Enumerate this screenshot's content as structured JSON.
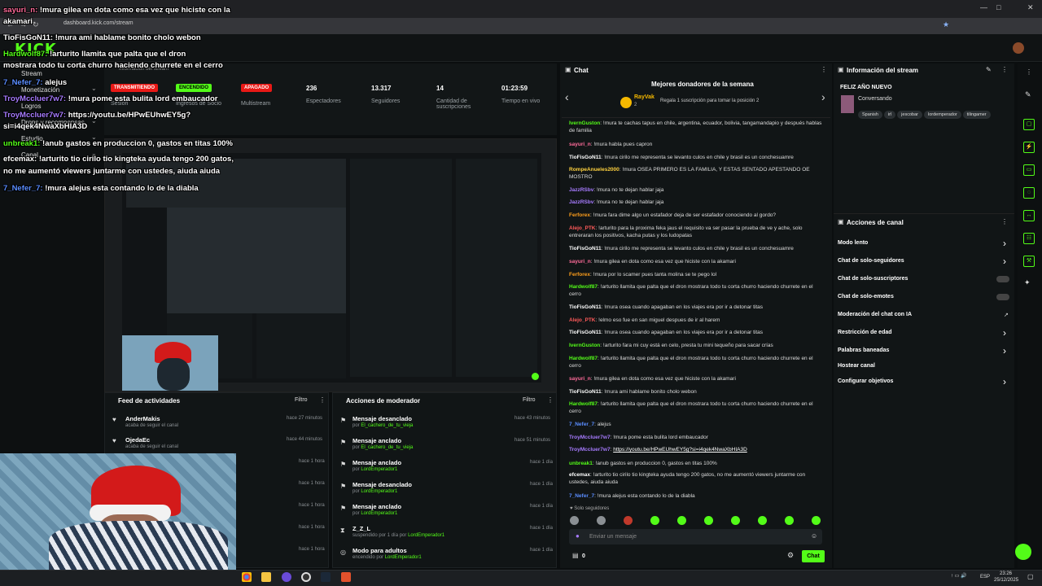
{
  "browser": {
    "url": "dashboard.kick.com/stream",
    "win_min": "—",
    "win_max": "□",
    "win_close": "✕",
    "back_glyph": "←",
    "fwd_glyph": "→",
    "reload_glyph": "↻",
    "star_glyph": "★"
  },
  "app": {
    "logo": "KICK"
  },
  "sidebar": {
    "items": [
      {
        "label": "Stream"
      },
      {
        "label": "Monetización"
      },
      {
        "label": "Logros"
      },
      {
        "label": "Drops y recompensas"
      },
      {
        "label": "Estudio"
      },
      {
        "label": "Canal"
      }
    ],
    "chevron": "⌄"
  },
  "stats": {
    "header": "Información del stream",
    "session": {
      "badge": "TRANSMITIENDO",
      "label": "Sesión"
    },
    "income": {
      "badge": "ENCENDIDO",
      "label": "Ingresos de Socio"
    },
    "multistream": {
      "badge": "APAGADO",
      "label": "Multistream"
    },
    "spectators": {
      "value": "236",
      "label": "Espectadores"
    },
    "followers": {
      "value": "13.317",
      "label": "Seguidores"
    },
    "subs": {
      "value": "14",
      "label": "Cantidad de suscripciones"
    },
    "live_time": {
      "value": "01:23:59",
      "label": "Tiempo en vivo"
    }
  },
  "feed": {
    "title": "Feed de actividades",
    "filter": "Filtro",
    "kebab": "⋮",
    "heart": "♥",
    "items": [
      {
        "name": "AnderMakis",
        "sub": "acaba de seguir el canal",
        "time": "hace 27 minutos"
      },
      {
        "name": "OjedaEc",
        "sub": "acaba de seguir el canal",
        "time": "hace 44 minutos"
      },
      {
        "name": "",
        "sub": "",
        "time": "hace 1 hora"
      },
      {
        "name": "",
        "sub": "",
        "time": "hace 1 hora"
      },
      {
        "name": "",
        "sub": "",
        "time": "hace 1 hora"
      },
      {
        "name": "",
        "sub": "",
        "time": "hace 1 hora"
      },
      {
        "name": "",
        "sub": "",
        "time": "hace 1 hora"
      }
    ]
  },
  "mod": {
    "title": "Acciones de moderador",
    "filter": "Filtro",
    "kebab": "⋮",
    "pin_glyph": "⚑",
    "items": [
      {
        "title": "Mensaje desanclado",
        "by": "por",
        "user": "El_cachero_de_tu_vieja",
        "time": "hace 43 minutos"
      },
      {
        "title": "Mensaje anclado",
        "by": "por",
        "user": "El_cachero_de_tu_vieja",
        "time": "hace 51 minutos"
      },
      {
        "title": "Mensaje anclado",
        "by": "por",
        "user": "LordEmperador1",
        "time": "hace 1 día"
      },
      {
        "title": "Mensaje desanclado",
        "by": "por",
        "user": "LordEmperador1",
        "time": "hace 1 día"
      },
      {
        "title": "Mensaje anclado",
        "by": "por",
        "user": "LordEmperador1",
        "time": "hace 1 día"
      },
      {
        "title": "Z_Z_L",
        "by": "suspendido por 1 día por",
        "user": "LordEmperador1",
        "time": "hace 1 día"
      },
      {
        "title": "Modo para adultos",
        "by": "encendido por",
        "user": "LordEmperador1",
        "time": "hace 1 día"
      }
    ]
  },
  "chat": {
    "title": "Chat",
    "donors_title": "Mejores donadores de la semana",
    "donor_name": "RayVak",
    "donor_rank": "2",
    "donor_cta": "Regala 1 suscripción para tomar la posición 2",
    "prev": "‹",
    "next": "›",
    "followers_only": "♥ Solo seguidores",
    "input_placeholder": "Enviar un mensaje",
    "send": "Chat",
    "count": "0",
    "gear": "⚙",
    "messages": [
      {
        "user": "IvernGuston",
        "color": "#53fc18",
        "text": "!mura te cachas tapus en chile, argentina, ecuador, bolivia, tangamandapio y después hablas de familia"
      },
      {
        "user": "sayuri_n",
        "color": "#ff6b9a",
        "text": "!mura habla pues capron"
      },
      {
        "user": "TioFisGoN11",
        "color": "#ffffff",
        "text": "!mura cirilo me representa se levanto culos en chile y brasil es un conchesuamre"
      },
      {
        "user": "RompeAnueles2000",
        "color": "#ffd23f",
        "text": "!mura OSEA PRIMERO ES LA FAMILIA, Y ESTAS SENTADO APESTANDO OE MOSTRO"
      },
      {
        "user": "JazzRSbv",
        "color": "#a77bff",
        "text": "!mura no te dejan hablar jaja"
      },
      {
        "user": "JazzRSbv",
        "color": "#a77bff",
        "text": "!mura no te dejan hablar jaja"
      },
      {
        "user": "Ferforex",
        "color": "#ff9f1c",
        "text": "!mura fara dime algo un estafador deja de ser estafador conociendo al gordo?"
      },
      {
        "user": "Alejo_PTK",
        "color": "#ff5a5a",
        "text": "!arturito para la proxima feka jaus el requisito va ser pasar la prueba de ve y ache, solo entreraran los positivos, kacha putas y los ludopatas"
      },
      {
        "user": "TioFisGoN11",
        "color": "#ffffff",
        "text": "!mura cirilo me representa se levanto culos en chile y brasil es un conchesuamre"
      },
      {
        "user": "sayuri_n",
        "color": "#ff6b9a",
        "text": "!mura gilea en dota como esa vez que hiciste con la akamari"
      },
      {
        "user": "Ferforex",
        "color": "#ff9f1c",
        "text": "!mura por lo scamer pues tanta molina se te pego lol"
      },
      {
        "user": "Hardwolf87",
        "color": "#53fc18",
        "text": "!arturito llamita que palta que el dron mostrara todo tu corta churro haciendo churrete en el cerro"
      },
      {
        "user": "TioFisGoN11",
        "color": "#ffffff",
        "text": "!mura osea cuando apagaban en los viajes era por ir a detonar titas"
      },
      {
        "user": "Alejo_PTK",
        "color": "#ff5a5a",
        "text": "!elmo eso fue en san miguel despues de ir al harem"
      },
      {
        "user": "TioFisGoN11",
        "color": "#ffffff",
        "text": "!mura osea cuando apagaban en los viajes era por ir a detonar titas"
      },
      {
        "user": "IvernGuston",
        "color": "#53fc18",
        "text": "!arturito fara mi cuy está en celo, presta tu mini tequeño para sacar crías"
      },
      {
        "user": "Hardwolf87",
        "color": "#53fc18",
        "text": "!arturito llamita que palta que el dron mostrara todo tu corta churro haciendo churrete en el cerro"
      },
      {
        "user": "sayuri_n",
        "color": "#ff6b9a",
        "text": "!mura gilea en dota como esa vez que hiciste con la akamari"
      },
      {
        "user": "TioFisGoN11",
        "color": "#ffffff",
        "text": "!mura ami hablame bonito cholo webon"
      },
      {
        "user": "Hardwolf87",
        "color": "#53fc18",
        "text": "!arturito llamita que palta que el dron mostrara todo tu corta churro haciendo churrete en el cerro"
      },
      {
        "user": "7_Nefer_7",
        "color": "#5a8dff",
        "text": "alejus"
      },
      {
        "user": "TroyMccluer7w7",
        "color": "#a77bff",
        "text": "!mura pome esta bulita lord embaucador"
      },
      {
        "user": "TroyMccluer7w7",
        "color": "#a77bff",
        "text": "https://youtu.be/HPwEUhwEY5g?si=i4qek4NwaXbHIA3D"
      },
      {
        "user": "unbreak1",
        "color": "#53fc18",
        "text": "!anub gastos en produccion 0, gastos en titas 100%"
      },
      {
        "user": "efcemax",
        "color": "#ffffff",
        "text": "!arturito tio cirilo tio kingteka ayuda tengo 200 gatos, no me aumentó viewers juntarme con ustedes, aiuda aiuda"
      },
      {
        "user": "7_Nefer_7",
        "color": "#5a8dff",
        "text": "!mura alejus esta contando lo de la diabla"
      }
    ]
  },
  "info": {
    "title": "Información del stream",
    "edit_icon": "✎",
    "stream_title": "FELIZ AÑO NUEVO",
    "category": "Conversando",
    "tags": [
      "Spanish",
      "irl",
      "jescobar",
      "lordemperador",
      "tilingamer"
    ]
  },
  "actions": {
    "title": "Acciones de canal",
    "arrow": "›",
    "items": [
      {
        "label": "Modo lento",
        "kind": "arrow"
      },
      {
        "label": "Chat de solo-seguidores",
        "kind": "arrow"
      },
      {
        "label": "Chat de solo-suscriptores",
        "kind": "toggle"
      },
      {
        "label": "Chat de solo-emotes",
        "kind": "toggle"
      },
      {
        "label": "Moderación del chat con IA",
        "kind": "link"
      },
      {
        "label": "Restricción de edad",
        "kind": "arrow"
      },
      {
        "label": "Palabras baneadas",
        "kind": "arrow"
      },
      {
        "label": "Hostear canal",
        "kind": "none"
      },
      {
        "label": "Configurar objetivos",
        "kind": "arrow"
      }
    ]
  },
  "overlay_chat": [
    {
      "user": "sayuri_n:",
      "color": "#ff6b9a",
      "text": " !mura gilea en dota como esa vez que hiciste con la"
    },
    {
      "user": "",
      "color": "#ffffff",
      "text": "akamari"
    },
    {
      "user": "TioFisGoN11:",
      "color": "#ffffff",
      "text": " !mura ami hablame bonito cholo webon"
    },
    {
      "user": "Hardwolf87:",
      "color": "#53fc18",
      "text": " !arturito llamita que palta que el dron"
    },
    {
      "user": "",
      "color": "#ffffff",
      "text": "mostrara todo tu corta churro haciendo churrete en el cerro"
    },
    {
      "user": "7_Nefer_7:",
      "color": "#5a8dff",
      "text": " alejus"
    },
    {
      "user": "TroyMccluer7w7:",
      "color": "#a77bff",
      "text": " !mura pome esta bulita lord embaucador"
    },
    {
      "user": "TroyMccluer7w7:",
      "color": "#a77bff",
      "text": " https://youtu.be/HPwEUhwEY5g?"
    },
    {
      "user": "",
      "color": "#ffffff",
      "text": "si=i4qek4NwaXbHIA3D"
    },
    {
      "user": "unbreak1:",
      "color": "#53fc18",
      "text": " !anub gastos en produccion 0, gastos en titas 100%"
    },
    {
      "user": "efcemax:",
      "color": "#ffffff",
      "text": " !arturito tio cirilo tio kingteka ayuda tengo 200 gatos,"
    },
    {
      "user": "",
      "color": "#ffffff",
      "text": "no me aumentó viewers juntarme con ustedes, aiuda aiuda"
    },
    {
      "user": "7_Nefer_7:",
      "color": "#5a8dff",
      "text": " !mura alejus esta contando lo de la diabla"
    }
  ],
  "taskbar": {
    "lang": "ESP",
    "time": "23:26",
    "date": "25/12/2025"
  },
  "colors": {
    "accent": "#53fc18",
    "live": "#e91916",
    "bg": "#0b0e0f"
  }
}
